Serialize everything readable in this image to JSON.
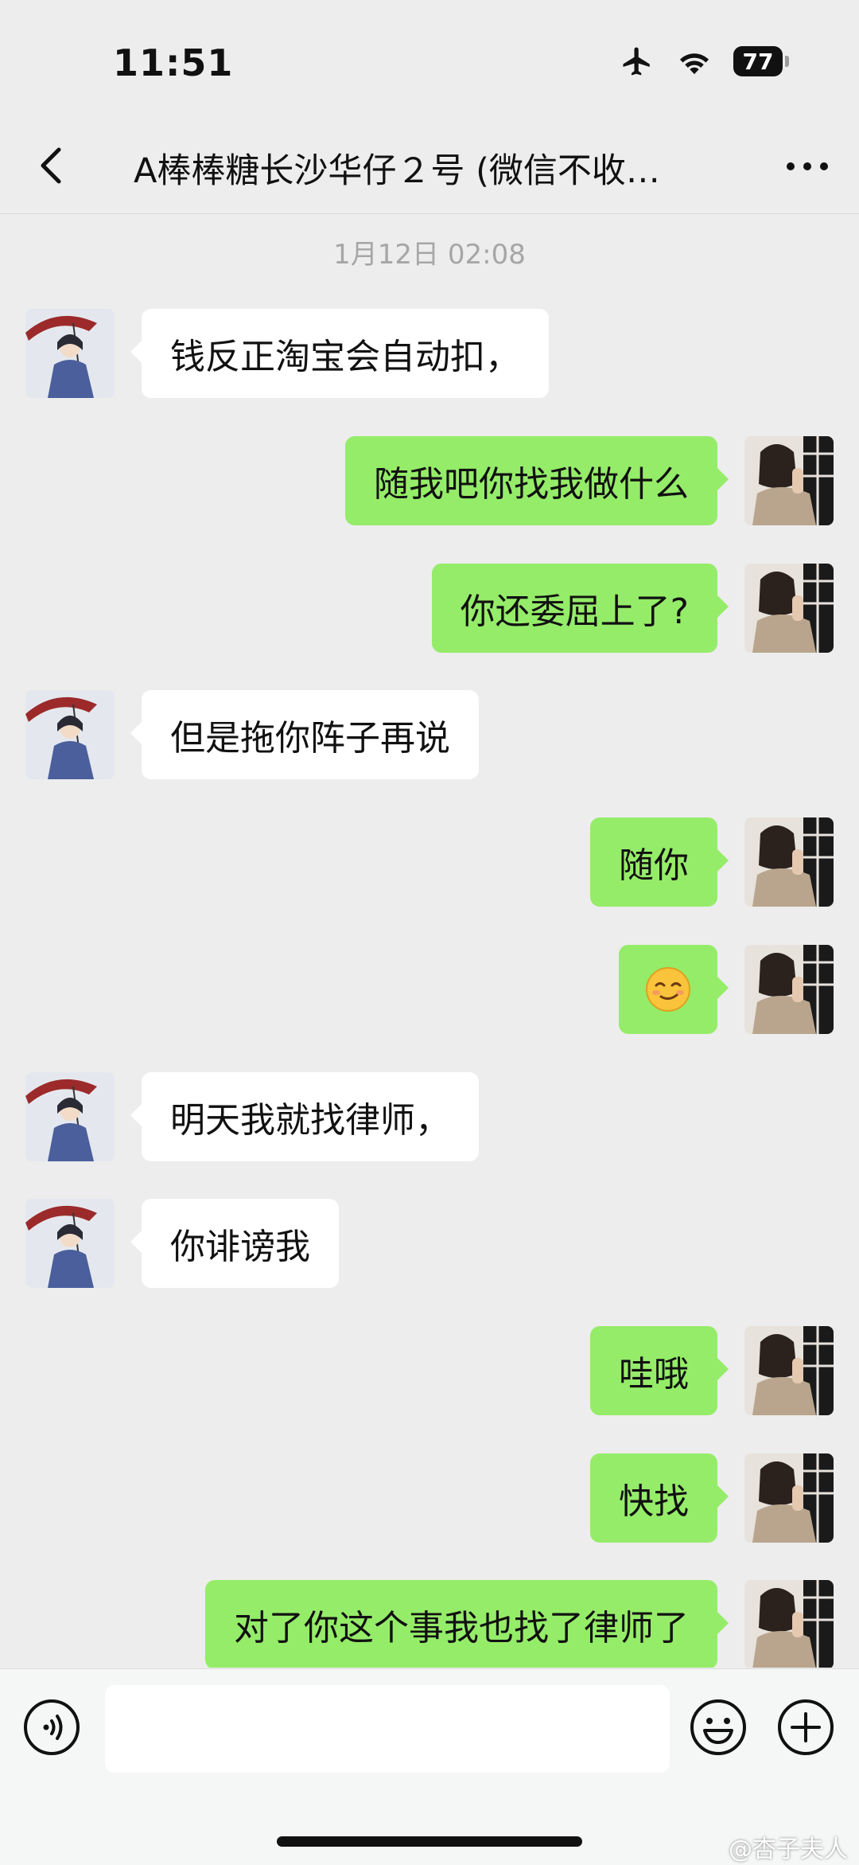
{
  "status_bar": {
    "time": "11:51",
    "battery": "77"
  },
  "header": {
    "title": "A棒棒糖长沙华仔２号 (微信不收…"
  },
  "chat": {
    "timestamp": "1月12日 02:08",
    "messages": [
      {
        "side": "in",
        "text": "钱反正淘宝会自动扣，"
      },
      {
        "side": "out",
        "text": "随我吧你找我做什么"
      },
      {
        "side": "out",
        "text": "你还委屈上了?"
      },
      {
        "side": "in",
        "text": "但是拖你阵子再说"
      },
      {
        "side": "out",
        "text": "随你"
      },
      {
        "side": "out",
        "emoji": "smirk-face-emoji"
      },
      {
        "side": "in",
        "text": "明天我就找律师，"
      },
      {
        "side": "in",
        "text": "你诽谤我"
      },
      {
        "side": "out",
        "text": "哇哦"
      },
      {
        "side": "out",
        "text": "快找"
      },
      {
        "side": "out",
        "text": "对了你这个事我也找了律师了"
      }
    ]
  },
  "input_bar": {
    "input_value": ""
  },
  "watermark": "@杏子夫人",
  "colors": {
    "background": "#ededed",
    "outgoing_bubble": "#95ec69",
    "incoming_bubble": "#ffffff"
  }
}
